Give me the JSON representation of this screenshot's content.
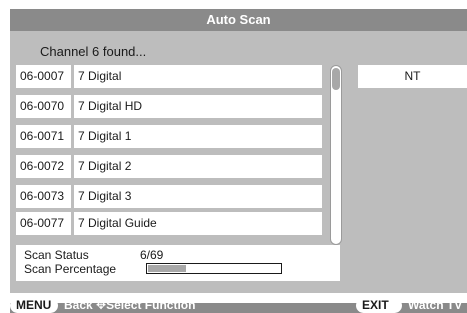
{
  "title": "Auto Scan",
  "found_message": "Channel 6 found...",
  "channels": [
    {
      "code": "06-0007",
      "name": "7 Digital"
    },
    {
      "code": "06-0070",
      "name": "7 Digital HD"
    },
    {
      "code": "06-0071",
      "name": "7 Digital 1"
    },
    {
      "code": "06-0072",
      "name": "7 Digital 2"
    },
    {
      "code": "06-0073",
      "name": "7 Digital 3"
    },
    {
      "code": "06-0077",
      "name": "7 Digital Guide"
    }
  ],
  "side_label": "NT",
  "scan": {
    "status_label": "Scan Status",
    "status_value": "6/69",
    "percentage_label": "Scan Percentage",
    "percentage_fraction": 0.3
  },
  "footer": {
    "menu_label": "MENU",
    "back_label": "Back",
    "select_label": "Select Function",
    "arrow_glyph": "✥",
    "exit_label": "EXIT",
    "watch_label": "Watch TV"
  },
  "colors": {
    "header": "#8a8a8a",
    "panel": "#bdbdbd",
    "progress_fill": "#a8a8a8"
  }
}
